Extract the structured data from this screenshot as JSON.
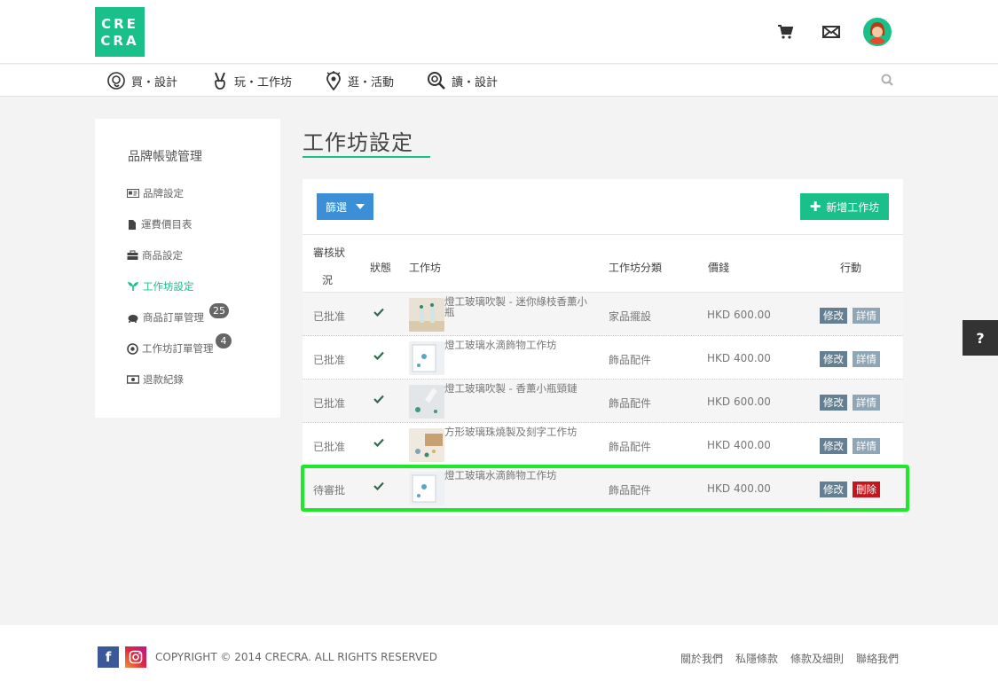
{
  "logo": {
    "line1": "CRE",
    "line2": "CRA"
  },
  "nav": [
    {
      "label": "買・設計"
    },
    {
      "label": "玩・工作坊"
    },
    {
      "label": "逛・活動"
    },
    {
      "label": "讀・設計"
    }
  ],
  "sidebar": {
    "title": "品牌帳號管理",
    "items": [
      {
        "label": "品牌設定"
      },
      {
        "label": "運費價目表"
      },
      {
        "label": "商品設定"
      },
      {
        "label": "工作坊設定"
      },
      {
        "label": "商品訂單管理",
        "badge": "25"
      },
      {
        "label": "工作坊訂單管理",
        "badge": "4"
      },
      {
        "label": "退款紀錄"
      }
    ]
  },
  "page": {
    "title": "工作坊設定"
  },
  "toolbar": {
    "filter_label": "篩選",
    "add_label": "新增工作坊",
    "add_plus": "✚"
  },
  "table": {
    "headers": {
      "review_line1": "審核狀",
      "review_line2": "況",
      "status": "狀態",
      "workshop": "工作坊",
      "category": "工作坊分類",
      "price": "價錢",
      "action": "行動"
    },
    "rows": [
      {
        "review": "已批准",
        "name": "燈工玻璃吹製 - 迷你綠枝香薰小瓶",
        "category": "家品擺設",
        "price": "HKD 600.00",
        "edit": "修改",
        "second": "詳情",
        "shade": true
      },
      {
        "review": "已批准",
        "name": "燈工玻璃水滴飾物工作坊",
        "category": "飾品配件",
        "price": "HKD 400.00",
        "edit": "修改",
        "second": "詳情",
        "shade": false
      },
      {
        "review": "已批准",
        "name": "燈工玻璃吹製 - 香薰小瓶頸鏈",
        "category": "飾品配件",
        "price": "HKD 600.00",
        "edit": "修改",
        "second": "詳情",
        "shade": true
      },
      {
        "review": "已批准",
        "name": "方形玻璃珠燒製及刻字工作坊",
        "category": "飾品配件",
        "price": "HKD 400.00",
        "edit": "修改",
        "second": "詳情",
        "shade": false
      },
      {
        "review": "待審批",
        "name": "燈工玻璃水滴飾物工作坊",
        "category": "飾品配件",
        "price": "HKD 400.00",
        "edit": "修改",
        "second": "刪除",
        "shade": true
      }
    ]
  },
  "help": {
    "label": "?"
  },
  "footer": {
    "fb": "f",
    "copyright": "COPYRIGHT © 2014 CRECRA. ALL RIGHTS RESERVED",
    "links": [
      "關於我們",
      "私隱條款",
      "條款及細則",
      "聯絡我們"
    ]
  },
  "colors": {
    "brand": "#19c08a",
    "filter": "#3a8fd6",
    "edit": "#647f91",
    "detail": "#8fa6b6",
    "delete": "#c4161c",
    "highlight": "#1de82a"
  }
}
